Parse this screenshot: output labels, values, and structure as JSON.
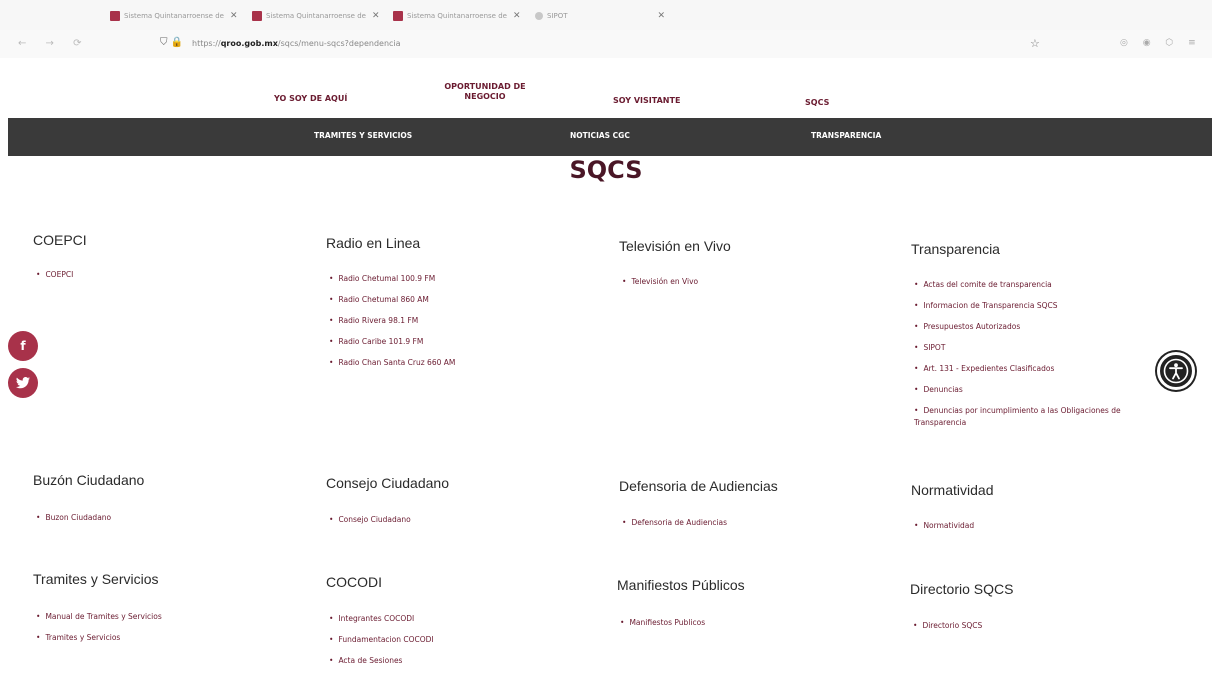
{
  "browser": {
    "tabs": [
      {
        "label": "Sistema Quintanarroense de",
        "icon": "site-favicon"
      },
      {
        "label": "Sistema Quintanarroense de",
        "icon": "site-favicon"
      },
      {
        "label": "Sistema Quintanarroense de",
        "icon": "site-favicon"
      },
      {
        "label": "SIPOT",
        "icon": "globe-icon"
      }
    ],
    "url_domain": "qroo.gob.mx",
    "url_prefix": "https://",
    "url_path": "/sqcs/menu-sqcs?dependencia"
  },
  "topnav": {
    "yo_soy": "YO SOY DE AQUÍ",
    "oportunidad": "OPORTUNIDAD DE NEGOCIO",
    "visitante": "SOY VISITANTE",
    "sqcs": "SQCS"
  },
  "darkbar": {
    "tramites": "TRAMITES Y SERVICIOS",
    "noticias": "NOTICIAS CGC",
    "transparencia": "TRANSPARENCIA"
  },
  "page_title": "SQCS",
  "sections": {
    "coepci": {
      "title": "COEPCI",
      "items": [
        "COEPCI"
      ]
    },
    "radio": {
      "title": "Radio en Linea",
      "items": [
        "Radio Chetumal 100.9 FM",
        "Radio Chetumal 860 AM",
        "Radio Rivera 98.1 FM",
        "Radio Caribe 101.9 FM",
        "Radio Chan Santa Cruz 660 AM"
      ]
    },
    "tv": {
      "title": "Televisión en Vivo",
      "items": [
        "Televisión en Vivo"
      ]
    },
    "transparencia": {
      "title": "Transparencia",
      "items": [
        "Actas del comite de transparencia",
        "Informacion de Transparencia SQCS",
        "Presupuestos Autorizados",
        "SIPOT",
        "Art. 131 - Expedientes Clasificados",
        "Denuncias",
        "Denuncias por incumplimiento a las Obligaciones de",
        "Transparencia"
      ]
    },
    "buzon": {
      "title": "Buzón Ciudadano",
      "items": [
        "Buzon Ciudadano"
      ]
    },
    "consejo": {
      "title": "Consejo Ciudadano",
      "items": [
        "Consejo Ciudadano"
      ]
    },
    "defensoria": {
      "title": "Defensoria de Audiencias",
      "items": [
        "Defensoria de Audiencias"
      ]
    },
    "normatividad": {
      "title": "Normatividad",
      "items": [
        "Normatividad"
      ]
    },
    "tramites": {
      "title": "Tramites y Servicios",
      "items": [
        "Manual de Tramites y Servicios",
        "Tramites y Servicios"
      ]
    },
    "cocodi": {
      "title": "COCODI",
      "items": [
        "Integrantes COCODI",
        "Fundamentacion COCODI",
        "Acta de Sesiones"
      ]
    },
    "manifiestos": {
      "title": "Manifiestos Públicos",
      "items": [
        "Manifiestos Publicos"
      ]
    },
    "directorio": {
      "title": "Directorio SQCS",
      "items": [
        "Directorio SQCS"
      ]
    }
  },
  "colors": {
    "accent": "#a8324a",
    "brand_text": "#6a1b30",
    "bar": "#3a3a3a"
  }
}
